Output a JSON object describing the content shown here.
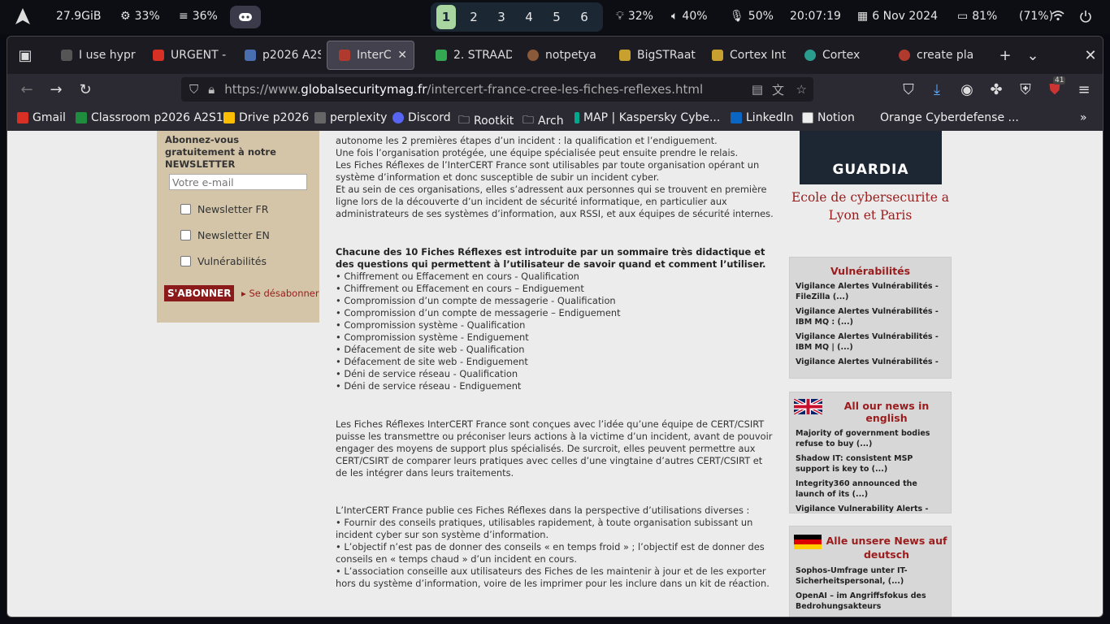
{
  "system_bar": {
    "memory": "27.9GiB",
    "cpu": "33%",
    "ram": "36%",
    "workspaces": [
      "1",
      "2",
      "3",
      "4",
      "5",
      "6"
    ],
    "active_workspace": "1",
    "brightness": "32%",
    "volume": "40%",
    "mic": "50%",
    "time": "20:07:19",
    "date": "6 Nov 2024",
    "battery": "81%",
    "battery_alt": "(71%)"
  },
  "tabs": [
    {
      "label": "I use hypr",
      "color": "#555"
    },
    {
      "label": "URGENT -",
      "color": "#d93025"
    },
    {
      "label": "p2026 A2S",
      "color": "#4a6fb0"
    },
    {
      "label": "InterCE",
      "color": "#b03a2e"
    },
    {
      "label": "2. STRAAD",
      "color": "#34a853"
    },
    {
      "label": "notpetya",
      "color": "#8a5a3a"
    },
    {
      "label": "BigSTRaat",
      "color": "#c8a030"
    },
    {
      "label": "Cortex Int",
      "color": "#c8a030"
    },
    {
      "label": "Cortex",
      "color": "#2a9d8f"
    },
    {
      "label": "create pla",
      "color": "#b03a2e"
    }
  ],
  "url": {
    "prefix": "https://www.",
    "host": "globalsecuritymag.fr",
    "path": "/intercert-france-cree-les-fiches-reflexes.html"
  },
  "bookmarks": [
    {
      "label": "Gmail",
      "color": "#d93025"
    },
    {
      "label": "Classroom p2026 A2S1",
      "color": "#1e8e3e"
    },
    {
      "label": "Drive p2026",
      "color": "#fbbc04"
    },
    {
      "label": "perplexity",
      "color": "#444"
    },
    {
      "label": "Discord",
      "color": "#5865f2"
    },
    {
      "label": "Rootkit",
      "color": "#2b2a33"
    },
    {
      "label": "Arch",
      "color": "#2b2a33"
    },
    {
      "label": "MAP | Kaspersky Cybe...",
      "color": "#00a88e"
    },
    {
      "label": "LinkedIn",
      "color": "#0a66c2"
    },
    {
      "label": "Notion",
      "color": "#eee"
    },
    {
      "label": "Orange Cyberdefense ...",
      "color": "#2b2a33"
    }
  ],
  "extension_badge": "41",
  "newsletter": {
    "title": "Abonnez-vous gratuitement à notre NEWSLETTER",
    "email_placeholder": "Votre e-mail",
    "options": [
      "Newsletter FR",
      "Newsletter EN",
      "Vulnérabilités"
    ],
    "subscribe": "S'ABONNER",
    "unsubscribe": "Se désabonner"
  },
  "article": {
    "p1": "autonome les 2 premières étapes d’un incident : la qualification et l’endiguement.\nUne fois l’organisation protégée, une équipe spécialisée peut ensuite prendre le relais.\nLes Fiches Réflexes de l’InterCERT France sont utilisables par toute organisation opérant un système d’information et donc susceptible de subir un incident cyber.\nEt au sein de ces organisations, elles s’adressent aux personnes qui se trouvent en première ligne lors de la découverte d’un incident de sécurité informatique, en particulier aux administrateurs de ses systèmes d’information, aux RSSI, et aux équipes de sécurité internes.",
    "p2_bold": "Chacune des 10 Fiches Réflexes est introduite par un sommaire très didactique et des questions qui permettent à l’utilisateur de savoir quand et comment l’utiliser.",
    "list": [
      "• Chiffrement ou Effacement en cours - Qualification",
      "• Chiffrement ou Effacement en cours – Endiguement",
      "• Compromission d’un compte de messagerie - Qualification",
      "• Compromission d’un compte de messagerie – Endiguement",
      "• Compromission système - Qualification",
      "• Compromission système - Endiguement",
      "• Défacement de site web - Qualification",
      "• Défacement de site web - Endiguement",
      "• Déni de service réseau - Qualification",
      "• Déni de service réseau - Endiguement"
    ],
    "p3": "Les Fiches Réflexes InterCERT France sont conçues avec l’idée qu’une équipe de CERT/CSIRT puisse les transmettre ou préconiser leurs actions à la victime d’un incident, avant de pouvoir engager des moyens de support plus spécialisés. De surcroit, elles peuvent permettre aux CERT/CSIRT de comparer leurs pratiques avec celles d’une vingtaine d’autres CERT/CSIRT et de les intégrer dans leurs traitements.",
    "p4": "L’InterCERT France publie ces Fiches Réflexes dans la perspective d’utilisations diverses :\n• Fournir des conseils pratiques, utilisables rapidement, à toute organisation subissant un incident cyber sur son système d’information.\n• L’objectif n’est pas de donner des conseils « en temps froid » ; l’objectif est de donner des conseils en « temps chaud » d’un incident en cours.\n• L’association conseille aux utilisateurs des Fiches de les maintenir à jour et de les exporter hors du système d’information, voire de les imprimer pour les inclure dans un kit de réaction."
  },
  "sidebar": {
    "banner": "GUARDIA",
    "ecole": "Ecole de cybersecurite a Lyon et Paris",
    "vuln": {
      "title": "Vulnérabilités",
      "items": [
        "Vigilance Alertes Vulnérabilités - FileZilla (...)",
        "Vigilance Alertes Vulnérabilités - IBM MQ : (...)",
        "Vigilance Alertes Vulnérabilités - IBM MQ | (...)",
        "Vigilance Alertes Vulnérabilités -"
      ]
    },
    "english": {
      "title": "All our news in english",
      "items": [
        "Majority of government bodies refuse to buy (...)",
        "Shadow IT: consistent MSP support is key to (...)",
        "Integrity360 announced the launch of its (...)",
        "Vigilance Vulnerability Alerts -"
      ]
    },
    "deutsch": {
      "title": "Alle unsere News auf deutsch",
      "items": [
        "Sophos-Umfrage unter IT-Sicherheitspersonal, (...)",
        "OpenAI – im Angriffsfokus des Bedrohungsakteurs"
      ]
    }
  }
}
